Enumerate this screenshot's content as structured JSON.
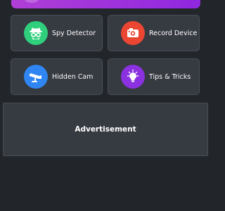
{
  "colors": {
    "background": "#22252a",
    "card": "#363a41",
    "banner_gradient": [
      "#b03fd6",
      "#8f27e0"
    ]
  },
  "cards": [
    {
      "label": "Spy Detector",
      "icon": "spy-icon",
      "icon_color": "#2fcf7d"
    },
    {
      "label": "Record Device",
      "icon": "camera-icon",
      "icon_color": "#ea4632"
    },
    {
      "label": "Hidden Cam",
      "icon": "cctv-icon",
      "icon_color": "#2f86f2"
    },
    {
      "label": "Tips & Tricks",
      "icon": "lightbulb-icon",
      "icon_color": "#8b31e0"
    }
  ],
  "ad": {
    "label": "Advertisement"
  }
}
